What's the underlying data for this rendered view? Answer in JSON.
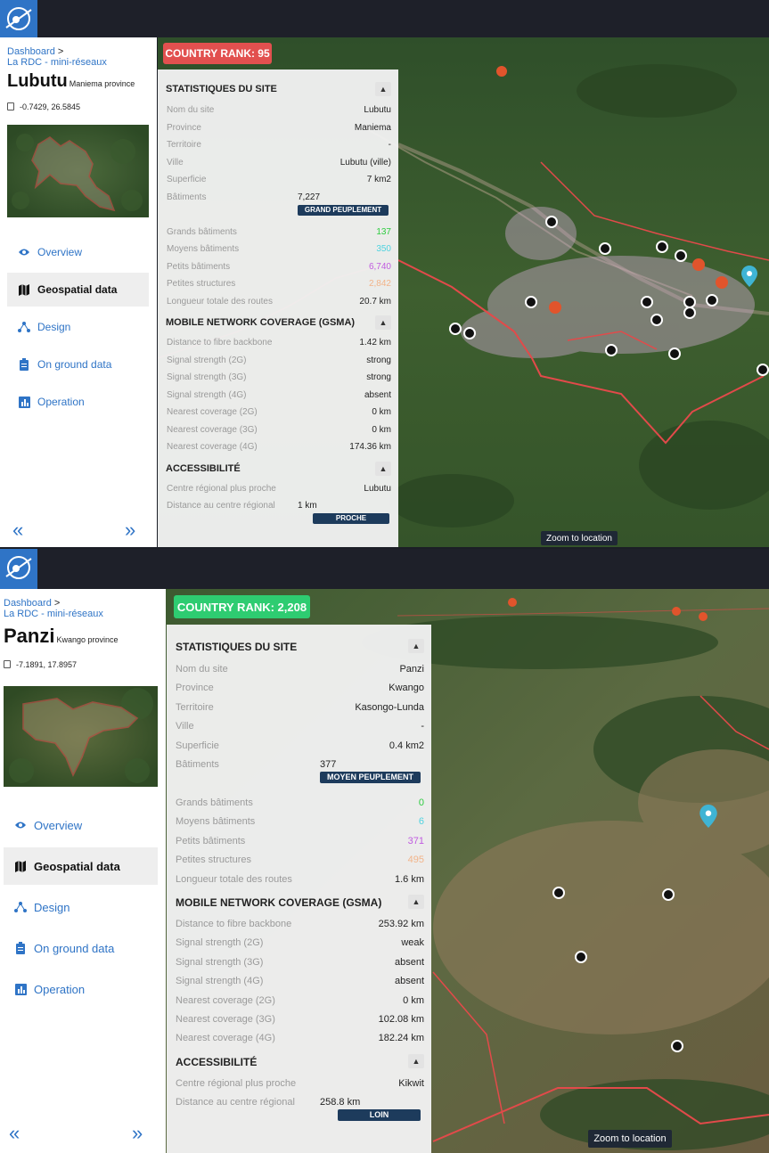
{
  "screens": [
    {
      "breadcrumb": {
        "root": "Dashboard",
        "sep": ">",
        "current": "La RDC - mini-réseaux"
      },
      "site_name": "Lubutu",
      "province_label": "Maniema province",
      "coordinates": "-0.7429, 26.5845",
      "nav": [
        "Overview",
        "Geospatial data",
        "Design",
        "On ground data",
        "Operation"
      ],
      "active_nav": "Geospatial data",
      "country_rank": "COUNTRY RANK: 95",
      "rank_color": "#e2504f",
      "zoom_button": "Zoom to location",
      "stats": {
        "title": "STATISTIQUES DU SITE",
        "rows": [
          {
            "k": "Nom du site",
            "v": "Lubutu"
          },
          {
            "k": "Province",
            "v": "Maniema"
          },
          {
            "k": "Territoire",
            "v": "-"
          },
          {
            "k": "Ville",
            "v": "Lubutu (ville)"
          },
          {
            "k": "Superficie",
            "v": "7 km2"
          }
        ],
        "buildings_label": "Bâtiments",
        "buildings_value": "7,227",
        "buildings_badge": "GRAND PEUPLEMENT",
        "rows2": [
          {
            "k": "Grands bâtiments",
            "v": "137",
            "color": "#2ecc40"
          },
          {
            "k": "Moyens bâtiments",
            "v": "350",
            "color": "#4fd3e0"
          },
          {
            "k": "Petits bâtiments",
            "v": "6,740",
            "color": "#c05ce0"
          },
          {
            "k": "Petites structures",
            "v": "2,842",
            "color": "#f2b48a"
          },
          {
            "k": "Longueur totale des routes",
            "v": "20.7 km",
            "color": "#222"
          }
        ]
      },
      "network": {
        "title": "MOBILE NETWORK COVERAGE (GSMA)",
        "rows": [
          {
            "k": "Distance to fibre backbone",
            "v": "1.42 km"
          },
          {
            "k": "Signal strength (2G)",
            "v": "strong"
          },
          {
            "k": "Signal strength (3G)",
            "v": "strong"
          },
          {
            "k": "Signal strength (4G)",
            "v": "absent"
          },
          {
            "k": "Nearest coverage (2G)",
            "v": "0 km"
          },
          {
            "k": "Nearest coverage (3G)",
            "v": "0 km"
          },
          {
            "k": "Nearest coverage (4G)",
            "v": "174.36 km"
          }
        ]
      },
      "access": {
        "title": "ACCESSIBILITÉ",
        "rows": [
          {
            "k": "Centre régional plus proche",
            "v": "Lubutu"
          }
        ],
        "distance_label": "Distance au centre régional",
        "distance_value": "1 km",
        "distance_badge": "PROCHE"
      }
    },
    {
      "breadcrumb": {
        "root": "Dashboard",
        "sep": ">",
        "current": "La RDC - mini-réseaux"
      },
      "site_name": "Panzi",
      "province_label": "Kwango province",
      "coordinates": "-7.1891, 17.8957",
      "nav": [
        "Overview",
        "Geospatial data",
        "Design",
        "On ground data",
        "Operation"
      ],
      "active_nav": "Geospatial data",
      "country_rank": "COUNTRY RANK: 2,208",
      "rank_color": "#2ecc71",
      "zoom_button": "Zoom to location",
      "stats": {
        "title": "STATISTIQUES DU SITE",
        "rows": [
          {
            "k": "Nom du site",
            "v": "Panzi"
          },
          {
            "k": "Province",
            "v": "Kwango"
          },
          {
            "k": "Territoire",
            "v": "Kasongo-Lunda"
          },
          {
            "k": "Ville",
            "v": "-"
          },
          {
            "k": "Superficie",
            "v": "0.4 km2"
          }
        ],
        "buildings_label": "Bâtiments",
        "buildings_value": "377",
        "buildings_badge": "MOYEN PEUPLEMENT",
        "rows2": [
          {
            "k": "Grands bâtiments",
            "v": "0",
            "color": "#2ecc40"
          },
          {
            "k": "Moyens bâtiments",
            "v": "6",
            "color": "#4fd3e0"
          },
          {
            "k": "Petits bâtiments",
            "v": "371",
            "color": "#c05ce0"
          },
          {
            "k": "Petites structures",
            "v": "495",
            "color": "#f2b48a"
          },
          {
            "k": "Longueur totale des routes",
            "v": "1.6 km",
            "color": "#222"
          }
        ]
      },
      "network": {
        "title": "MOBILE NETWORK COVERAGE (GSMA)",
        "rows": [
          {
            "k": "Distance to fibre backbone",
            "v": "253.92 km"
          },
          {
            "k": "Signal strength (2G)",
            "v": "weak"
          },
          {
            "k": "Signal strength (3G)",
            "v": "absent"
          },
          {
            "k": "Signal strength (4G)",
            "v": "absent"
          },
          {
            "k": "Nearest coverage (2G)",
            "v": "0 km"
          },
          {
            "k": "Nearest coverage (3G)",
            "v": "102.08 km"
          },
          {
            "k": "Nearest coverage (4G)",
            "v": "182.24 km"
          }
        ]
      },
      "access": {
        "title": "ACCESSIBILITÉ",
        "rows": [
          {
            "k": "Centre régional plus proche",
            "v": "Kikwit"
          }
        ],
        "distance_label": "Distance au centre régional",
        "distance_value": "258.8 km",
        "distance_badge": "LOIN"
      }
    }
  ]
}
